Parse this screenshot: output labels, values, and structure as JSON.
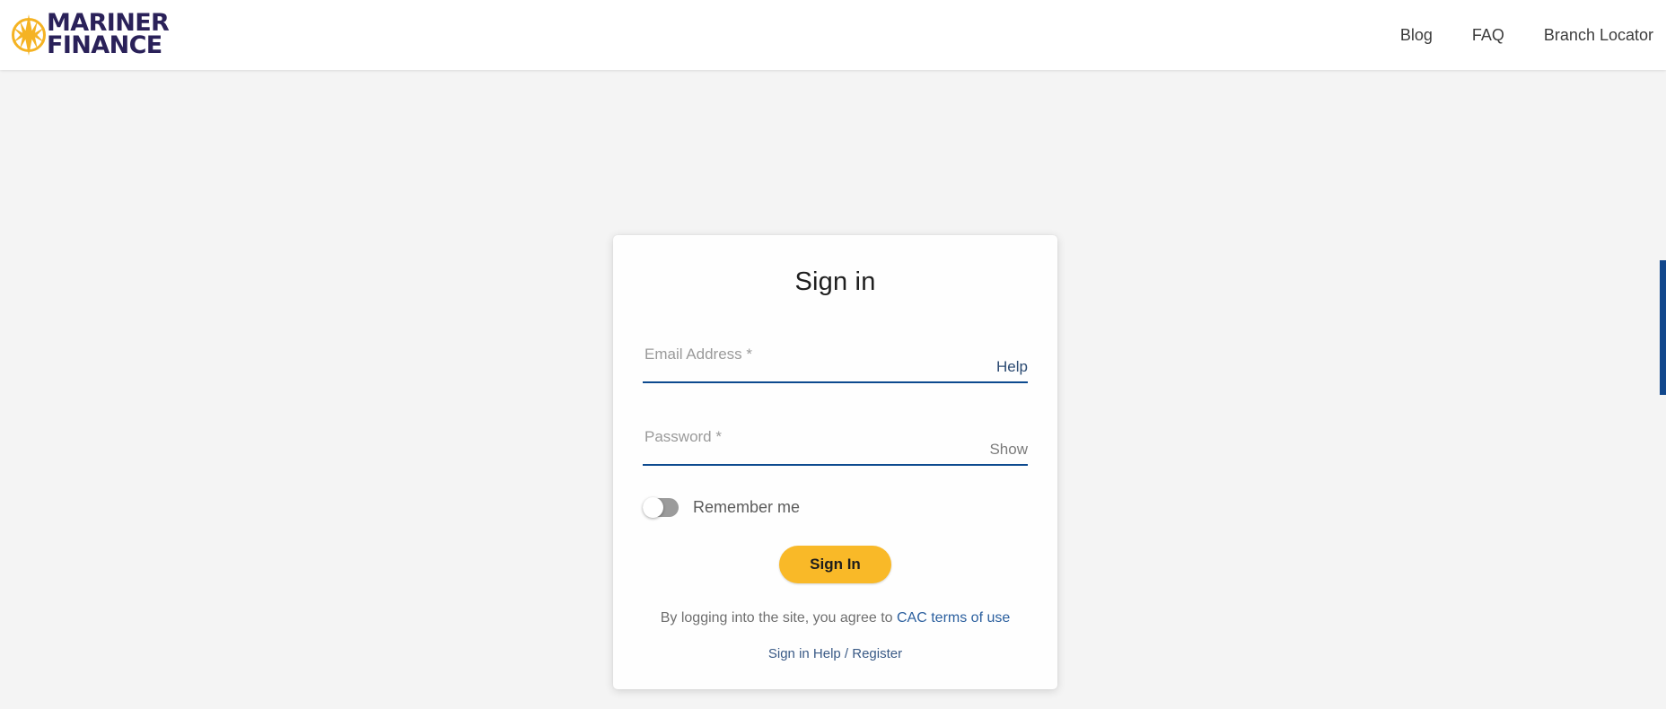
{
  "header": {
    "brand": {
      "icon": "compass-star-icon",
      "line1": "MARINER",
      "line2": "FINANCE",
      "mark_color": "#f5b323",
      "text_color": "#2a2159"
    },
    "nav": [
      {
        "label": "Blog"
      },
      {
        "label": "FAQ"
      },
      {
        "label": "Branch Locator"
      }
    ]
  },
  "signin": {
    "title": "Sign in",
    "email": {
      "label": "Email Address *",
      "placeholder": "Email Address *",
      "value": "",
      "action_label": "Help"
    },
    "password": {
      "label": "Password *",
      "placeholder": "Password *",
      "value": "",
      "action_label": "Show"
    },
    "remember": {
      "label": "Remember me",
      "checked": false
    },
    "submit_label": "Sign In",
    "terms_prefix": "By logging into the site, you agree to ",
    "terms_link": "CAC terms of use",
    "footer_link": "Sign in Help / Register"
  },
  "edge_tab": {
    "name": "page-scrollbar-thumb",
    "color": "#11478c"
  },
  "colors": {
    "accent_yellow": "#f9b928",
    "brand_navy": "#2a2159",
    "field_underline": "#0d4a8f",
    "link_blue": "#2b5f9e",
    "page_background": "#f4f4f4"
  }
}
